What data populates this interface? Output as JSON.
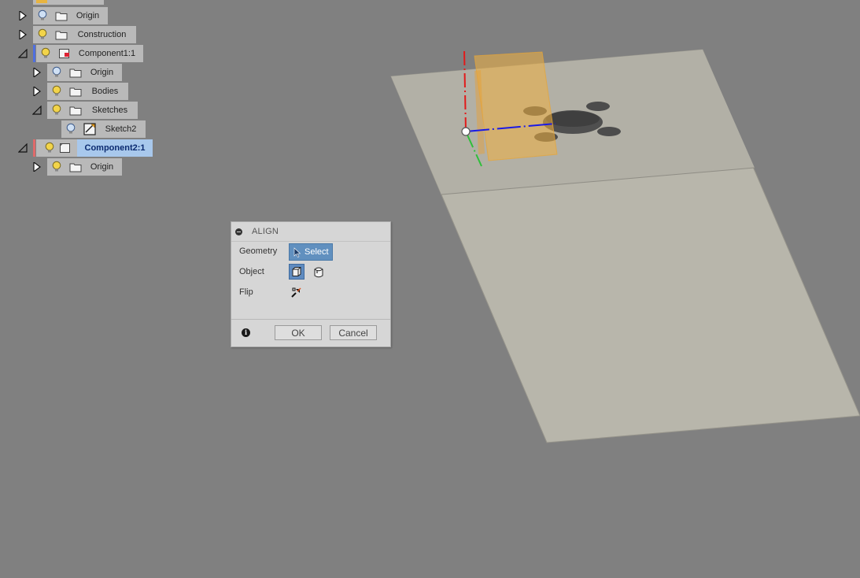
{
  "browser": {
    "items": [
      {
        "label": "Origin"
      },
      {
        "label": "Construction"
      },
      {
        "label": "Component1:1"
      },
      {
        "label": "Origin"
      },
      {
        "label": "Bodies"
      },
      {
        "label": "Sketches"
      },
      {
        "label": "Sketch2"
      },
      {
        "label": "Component2:1"
      },
      {
        "label": "Origin"
      }
    ]
  },
  "dialog": {
    "title": "ALIGN",
    "geometry_label": "Geometry",
    "select_label": "Select",
    "object_label": "Object",
    "flip_label": "Flip",
    "ok_label": "OK",
    "cancel_label": "Cancel",
    "info_glyph": "i"
  },
  "colors": {
    "viewport_bg": "#808080",
    "panel_grey": "#b9b9b9",
    "active_highlight": "#a8c8ec",
    "select_blue": "#6190bf",
    "plane_orange": "#f0b040",
    "bulb_yellow": "#f2d44a",
    "component1_stripe": "#4f6fe0",
    "component2_stripe": "#e06a6a"
  }
}
